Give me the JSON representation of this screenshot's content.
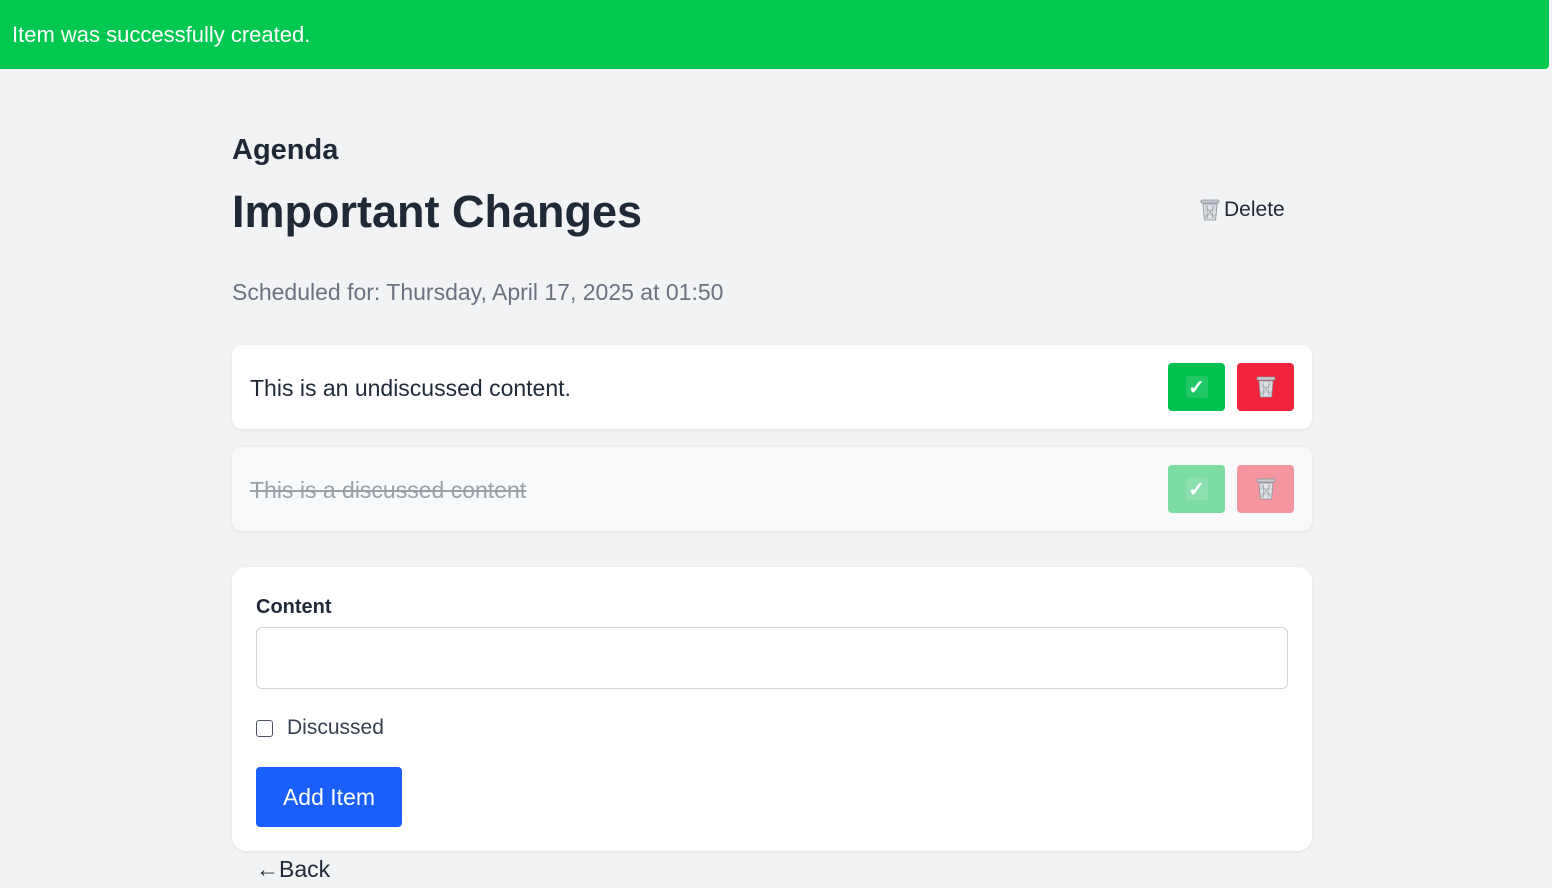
{
  "flash": {
    "message": "Item was successfully created.",
    "color": "#00c851"
  },
  "header": {
    "eyebrow": "Agenda",
    "title": "Important Changes",
    "delete_label": "Delete",
    "delete_icon": "wastebasket-icon"
  },
  "schedule": {
    "text": "Scheduled for: Thursday, April 17, 2025 at 01:50"
  },
  "items": [
    {
      "content": "This is an undiscussed content.",
      "discussed": false,
      "check_icon": "check-icon",
      "trash_icon": "wastebasket-icon"
    },
    {
      "content": "This is a discussed content",
      "discussed": true,
      "check_icon": "check-icon",
      "trash_icon": "wastebasket-icon"
    }
  ],
  "form": {
    "content_label": "Content",
    "content_value": "",
    "discussed_label": "Discussed",
    "discussed_checked": false,
    "submit_label": "Add Item"
  },
  "nav": {
    "back_label": "←Back"
  },
  "colors": {
    "success": "#00c14f",
    "danger": "#f0243a",
    "primary": "#1a5ffa",
    "background": "#f2f3f5"
  }
}
